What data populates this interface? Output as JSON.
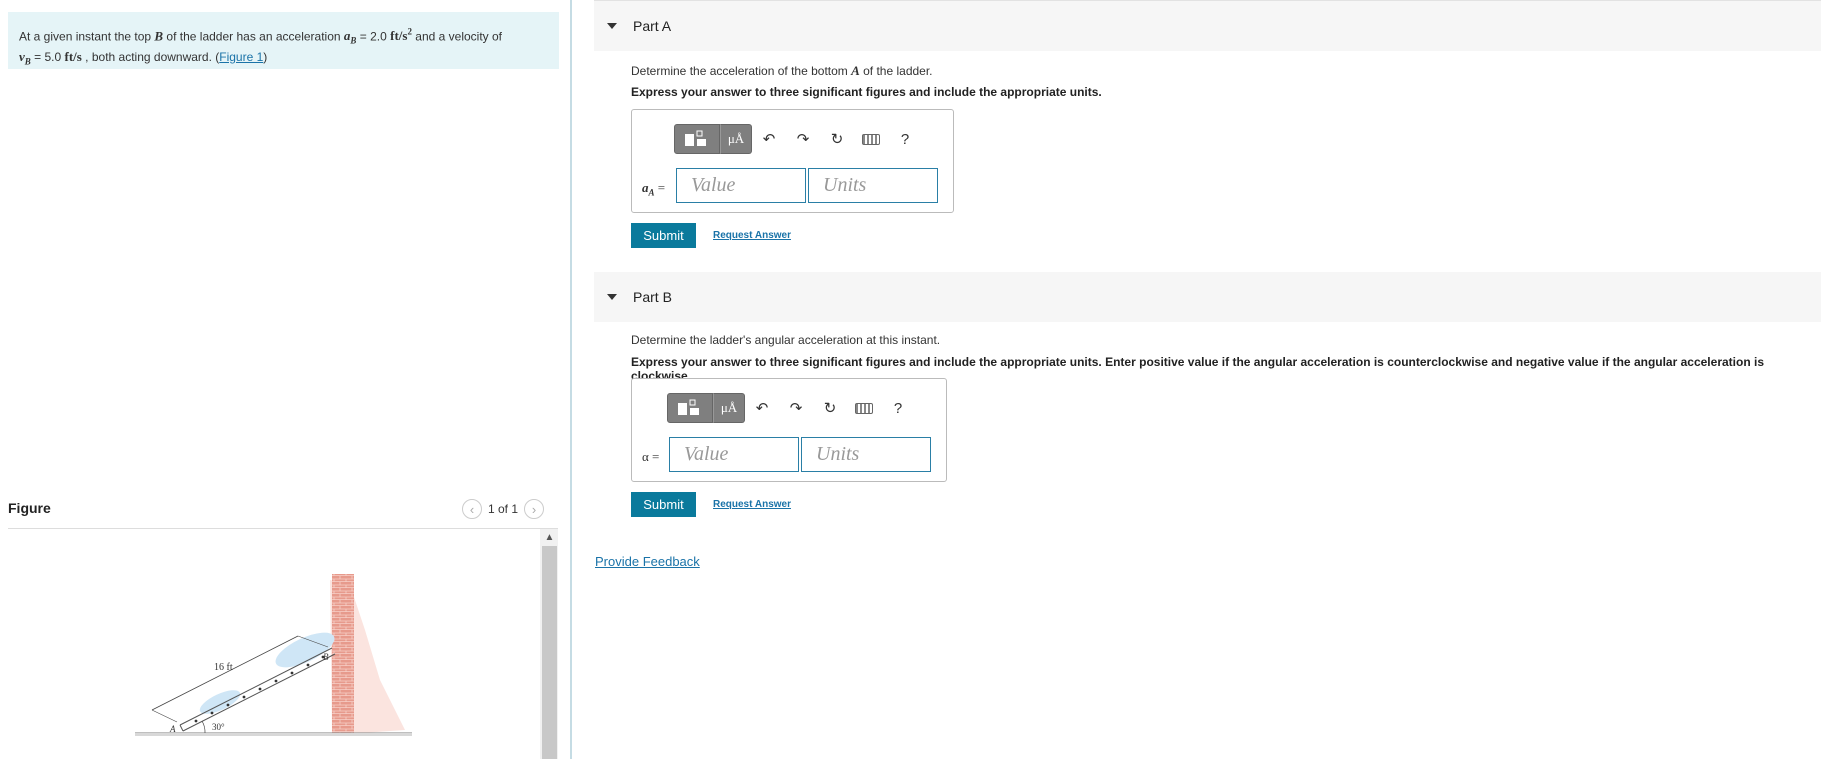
{
  "problem": {
    "text1": "At a given instant the top ",
    "B": "B",
    "text2": " of the ladder has an acceleration ",
    "aB_sym": "aB",
    "aB_eq": " = 2.0 ",
    "aB_unit": "ft/s²",
    "text3": " and a velocity of",
    "vB_sym": "vB",
    "vB_eq": " = 5.0 ",
    "vB_unit": "ft/s",
    "text4": " , both acting downward. (",
    "fig_link": "Figure 1",
    "text5": ")"
  },
  "figure_panel": {
    "title": "Figure",
    "counter": "1 of 1",
    "prev_icon": "‹",
    "next_icon": "›",
    "labels": {
      "length": "16 ft",
      "angle": "30°",
      "A": "A",
      "B": "B"
    }
  },
  "partA": {
    "title": "Part A",
    "question_pre": "Determine the acceleration of the bottom ",
    "question_sym": "A",
    "question_post": " of the ladder.",
    "instruction": "Express your answer to three significant figures and include the appropriate units.",
    "label_sym": "aA",
    "label_eq": " =",
    "value_placeholder": "Value",
    "units_placeholder": "Units",
    "submit": "Submit",
    "request": "Request Answer"
  },
  "partB": {
    "title": "Part B",
    "question": "Determine the ladder's angular acceleration at this instant.",
    "instruction": "Express your answer to three significant figures and include the appropriate units. Enter positive value if the angular acceleration is counterclockwise and negative value if the angular acceleration is clockwise.",
    "label": "α =",
    "value_placeholder": "Value",
    "units_placeholder": "Units",
    "submit": "Submit",
    "request": "Request Answer"
  },
  "toolbar": {
    "mu_label": "μÅ",
    "help": "?",
    "undo": "↶",
    "redo": "↷",
    "reset": "↻"
  },
  "feedback": "Provide Feedback"
}
